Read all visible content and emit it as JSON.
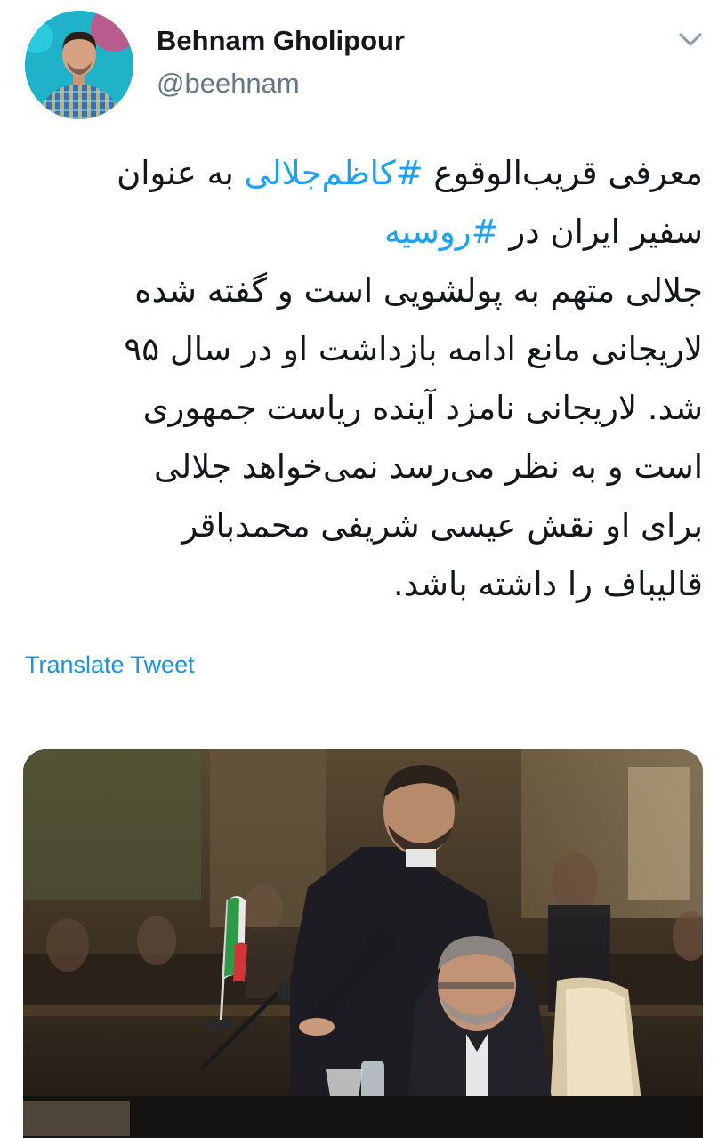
{
  "author": {
    "name": "Behnam Gholipour",
    "handle": "@beehnam",
    "avatar_icon": "profile-photo"
  },
  "menu": {
    "icon": "chevron-down-icon"
  },
  "tweet": {
    "lines": [
      [
        {
          "text": "معرفی قریب‌الوقوع ",
          "hashtag": false
        },
        {
          "text": "#کاظم‌جلالی",
          "hashtag": true
        },
        {
          "text": " به عنوان",
          "hashtag": false
        }
      ],
      [
        {
          "text": "سفیر ایران در ",
          "hashtag": false
        },
        {
          "text": "#روسیه",
          "hashtag": true
        }
      ],
      [
        {
          "text": "جلالی متهم به پولشویی است و گفته شده",
          "hashtag": false
        }
      ],
      [
        {
          "text": "لاریجانی مانع ادامه بازداشت او در سال ۹۵",
          "hashtag": false
        }
      ],
      [
        {
          "text": "شد. لاریجانی نامزد آینده ریاست جمهوری",
          "hashtag": false
        }
      ],
      [
        {
          "text": "است و به نظر می‌رسد نمی‌خواهد جلالی",
          "hashtag": false
        }
      ],
      [
        {
          "text": "برای او نقش عیسی شریفی محمدباقر",
          "hashtag": false
        }
      ],
      [
        {
          "text": "قالیباف را داشته باشد.",
          "hashtag": false
        }
      ]
    ],
    "translate_label": "Translate Tweet"
  },
  "colors": {
    "hashtag": "#1da1f2",
    "link": "#1b95e0",
    "handle": "#657786",
    "text": "#14171a"
  },
  "media": {
    "icon": "photo",
    "alt": ""
  }
}
